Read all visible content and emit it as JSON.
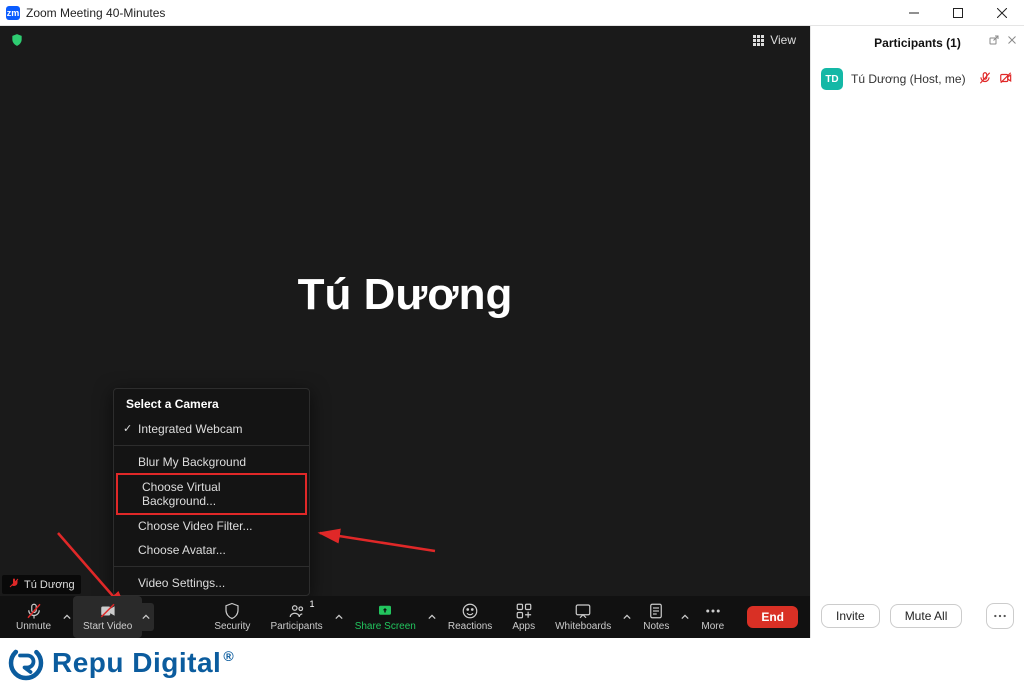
{
  "window": {
    "title": "Zoom Meeting 40-Minutes"
  },
  "meeting": {
    "view_label": "View",
    "display_name": "Tú Dương",
    "name_tag": "Tú Dương"
  },
  "camera_menu": {
    "header": "Select a Camera",
    "integrated": "Integrated Webcam",
    "blur": "Blur My Background",
    "virtual_bg": "Choose Virtual Background...",
    "video_filter": "Choose Video Filter...",
    "avatar": "Choose Avatar...",
    "settings": "Video Settings..."
  },
  "toolbar": {
    "unmute": "Unmute",
    "start_video": "Start Video",
    "security": "Security",
    "participants": "Participants",
    "participants_badge": "1",
    "share_screen": "Share Screen",
    "reactions": "Reactions",
    "apps": "Apps",
    "whiteboards": "Whiteboards",
    "notes": "Notes",
    "more": "More",
    "end": "End"
  },
  "participants_panel": {
    "title": "Participants (1)",
    "items": [
      {
        "initials": "TD",
        "label": "Tú Dương (Host, me)"
      }
    ],
    "invite": "Invite",
    "mute_all": "Mute All"
  },
  "brand": {
    "text": "Repu Digital",
    "reg": "®"
  }
}
